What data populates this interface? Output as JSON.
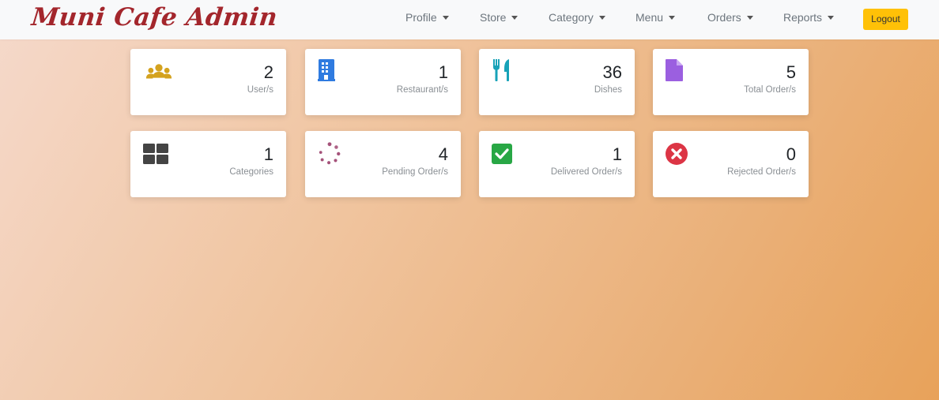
{
  "brand": {
    "title": "Muni Cafe Admin",
    "color": "#a3262c"
  },
  "nav": {
    "items": [
      {
        "label": "Profile"
      },
      {
        "label": "Store"
      },
      {
        "label": "Category"
      },
      {
        "label": "Menu"
      },
      {
        "label": "Orders"
      },
      {
        "label": "Reports"
      }
    ],
    "logout_label": "Logout"
  },
  "stats": {
    "users": {
      "count": "2",
      "label": "User/s",
      "icon": "users-icon",
      "color": "#d4a21e"
    },
    "restaurants": {
      "count": "1",
      "label": "Restaurant/s",
      "icon": "building-icon",
      "color": "#2f7be0"
    },
    "dishes": {
      "count": "36",
      "label": "Dishes",
      "icon": "utensils-icon",
      "color": "#17a2b8"
    },
    "total_orders": {
      "count": "5",
      "label": "Total Order/s",
      "icon": "file-icon",
      "color": "#9b5fe0"
    },
    "categories": {
      "count": "1",
      "label": "Categories",
      "icon": "grid-icon",
      "color": "#444444"
    },
    "pending_orders": {
      "count": "4",
      "label": "Pending Order/s",
      "icon": "spinner-icon",
      "color": "#a5527a"
    },
    "delivered_orders": {
      "count": "1",
      "label": "Delivered Order/s",
      "icon": "check-square-icon",
      "color": "#28a745"
    },
    "rejected_orders": {
      "count": "0",
      "label": "Rejected Order/s",
      "icon": "times-circle-icon",
      "color": "#dc3545"
    }
  }
}
